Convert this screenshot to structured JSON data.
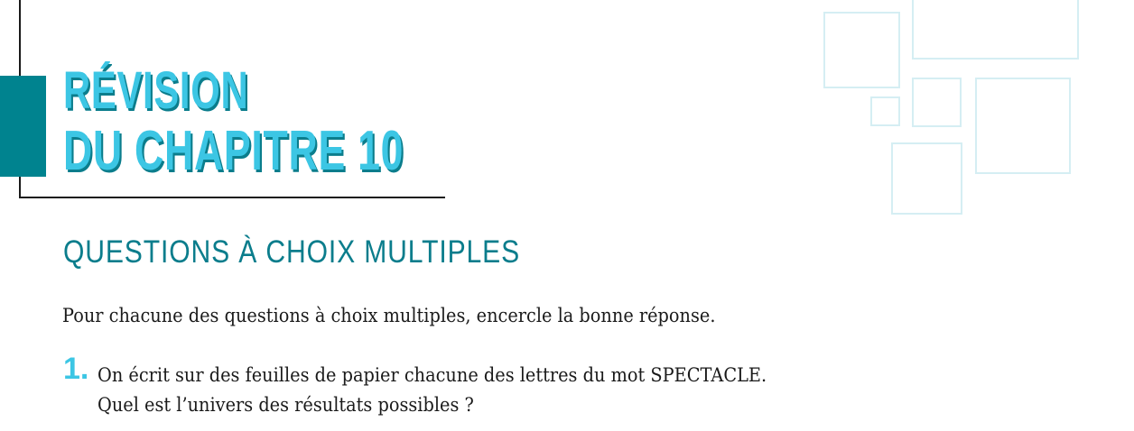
{
  "chapter_title": {
    "line1": "RÉVISION",
    "line2": "DU CHAPITRE 10"
  },
  "section": {
    "heading": "QUESTIONS À CHOIX MULTIPLES",
    "instructions": "Pour chacune des questions à choix multiples, encercle la bonne réponse."
  },
  "questions": [
    {
      "number": "1.",
      "line1": "On écrit sur des feuilles de papier chacune des lettres du mot SPECTACLE.",
      "line2": "Quel est l’univers des résultats possibles ?"
    }
  ],
  "colors": {
    "title_fill": "#3cc6e4",
    "title_shadow": "#0b7d8c",
    "accent_tab": "#00838f",
    "heading": "#0b7d8c",
    "decor_squares": "#d5eef3"
  }
}
